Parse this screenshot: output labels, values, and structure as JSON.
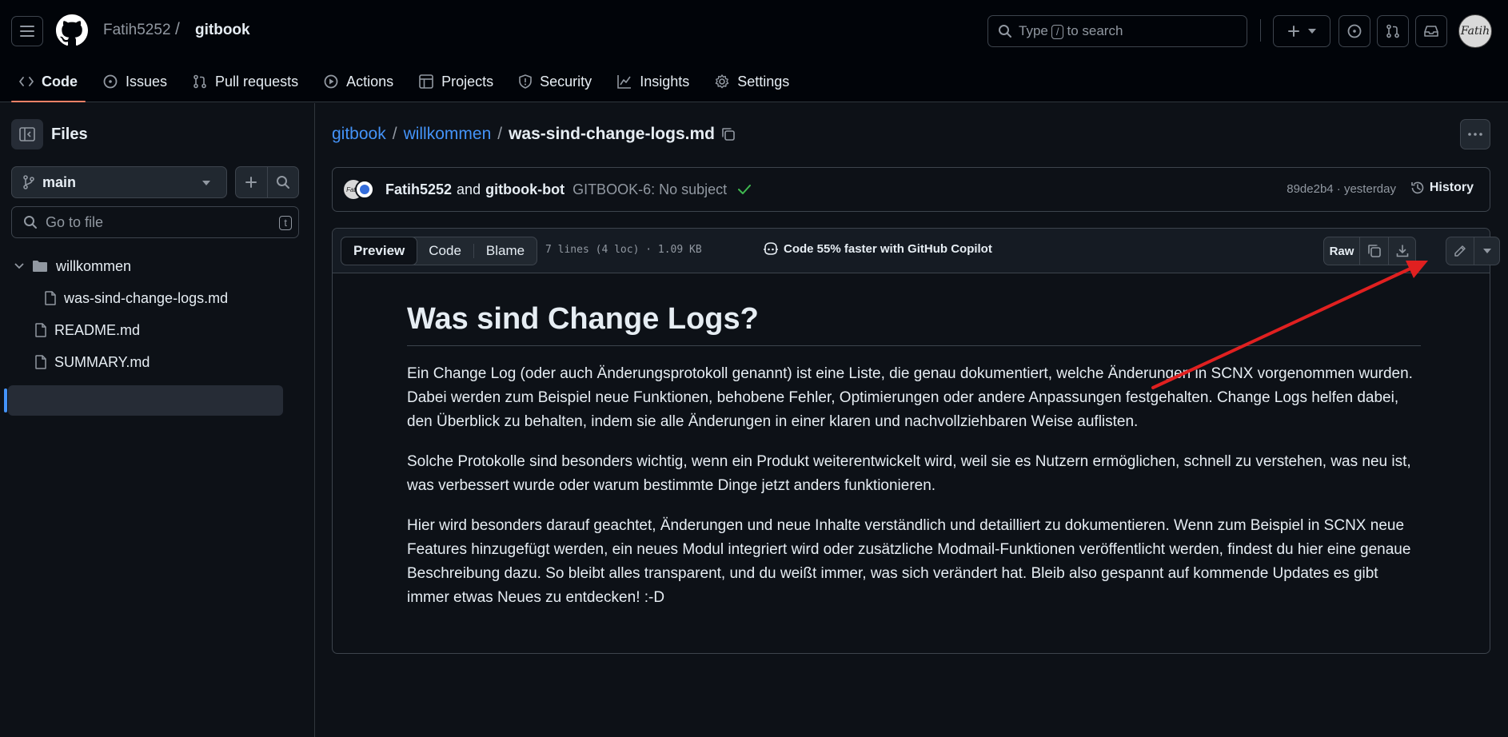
{
  "header": {
    "owner": "Fatih5252",
    "separator": "/",
    "repo": "gitbook",
    "search_prefix": "Type",
    "search_key": "/",
    "search_suffix": "to search",
    "avatar_text": "Fatih"
  },
  "tabs": [
    {
      "label": "Code",
      "icon": "code-icon",
      "active": true
    },
    {
      "label": "Issues",
      "icon": "issue-icon"
    },
    {
      "label": "Pull requests",
      "icon": "pull-request-icon"
    },
    {
      "label": "Actions",
      "icon": "play-icon"
    },
    {
      "label": "Projects",
      "icon": "table-icon"
    },
    {
      "label": "Security",
      "icon": "shield-icon"
    },
    {
      "label": "Insights",
      "icon": "graph-icon"
    },
    {
      "label": "Settings",
      "icon": "gear-icon"
    }
  ],
  "sidebar": {
    "title": "Files",
    "branch": "main",
    "goto_placeholder": "Go to file",
    "goto_key": "t",
    "tree": [
      {
        "label": "willkommen",
        "type": "folder",
        "expanded": true
      },
      {
        "label": "was-sind-change-logs.md",
        "type": "file",
        "selected": true
      },
      {
        "label": "README.md",
        "type": "file"
      },
      {
        "label": "SUMMARY.md",
        "type": "file"
      }
    ]
  },
  "breadcrumb": {
    "root": "gitbook",
    "sep": "/",
    "folder": "willkommen",
    "file": "was-sind-change-logs.md"
  },
  "commit": {
    "author1": "Fatih5252",
    "and": "and",
    "author2": "gitbook-bot",
    "message": "GITBOOK-6: No subject",
    "sha_time": "89de2b4 · yesterday",
    "history": "History"
  },
  "file": {
    "tabs": [
      "Preview",
      "Code",
      "Blame"
    ],
    "info": "7 lines (4 loc) · 1.09 KB",
    "copilot": "Code 55% faster with GitHub Copilot",
    "raw": "Raw"
  },
  "article": {
    "title": "Was sind Change Logs?",
    "paragraphs": [
      "Ein Change Log (oder auch Änderungsprotokoll genannt) ist eine Liste, die genau dokumentiert, welche Änderungen in SCNX vorgenommen wurden. Dabei werden zum Beispiel neue Funktionen, behobene Fehler, Optimierungen oder andere Anpassungen festgehalten. Change Logs helfen dabei, den Überblick zu behalten, indem sie alle Änderungen in einer klaren und nachvollziehbaren Weise auflisten.",
      "Solche Protokolle sind besonders wichtig, wenn ein Produkt weiterentwickelt wird, weil sie es Nutzern ermöglichen, schnell zu verstehen, was neu ist, was verbessert wurde oder warum bestimmte Dinge jetzt anders funktionieren.",
      "Hier wird besonders darauf geachtet, Änderungen und neue Inhalte verständlich und detailliert zu dokumentieren. Wenn zum Beispiel in SCNX neue Features hinzugefügt werden, ein neues Modul integriert wird oder zusätzliche Modmail-Funktionen veröffentlicht werden, findest du hier eine genaue Beschreibung dazu. So bleibt alles transparent, und du weißt immer, was sich verändert hat. Bleib also gespannt auf kommende Updates es gibt immer etwas Neues zu entdecken! :-D"
    ]
  },
  "colors": {
    "accent_link": "#4493f8",
    "tab_underline": "#f78166",
    "annotation_arrow": "#e02020",
    "check": "#3fb950"
  }
}
